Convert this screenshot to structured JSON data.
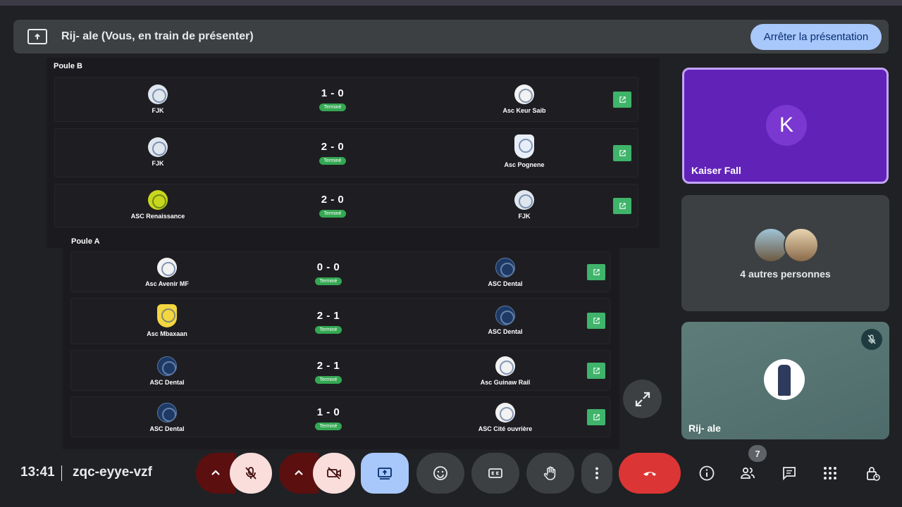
{
  "banner": {
    "title": "Rij- ale (Vous, en train de présenter)",
    "stop_label": "Arrêter la présentation"
  },
  "shared": {
    "poule_b": {
      "label": "Poule B",
      "matches": [
        {
          "home": "FJK",
          "score": "1 - 0",
          "status": "Terminé",
          "away": "Asc Keur Saib"
        },
        {
          "home": "FJK",
          "score": "2 - 0",
          "status": "Terminé",
          "away": "Asc Pognene"
        },
        {
          "home": "ASC Renaissance",
          "score": "2 - 0",
          "status": "Terminé",
          "away": "FJK"
        }
      ]
    },
    "poule_a": {
      "label": "Poule A",
      "matches": [
        {
          "home": "Asc Avenir MF",
          "score": "0 - 0",
          "status": "Terminé",
          "away": "ASC Dental"
        },
        {
          "home": "Asc Mbaxaan",
          "score": "2 - 1",
          "status": "Terminé",
          "away": "ASC Dental"
        },
        {
          "home": "ASC Dental",
          "score": "2 - 1",
          "status": "Terminé",
          "away": "Asc Guinaw Rail"
        },
        {
          "home": "ASC Dental",
          "score": "1 - 0",
          "status": "Terminé",
          "away": "ASC Cité ouvrière"
        }
      ]
    }
  },
  "participants": {
    "kaiser": {
      "initial": "K",
      "name": "Kaiser Fall"
    },
    "others": {
      "label": "4 autres personnes"
    },
    "self": {
      "name": "Rij- ale"
    }
  },
  "bottom": {
    "time": "13:41",
    "meeting_code": "zqc-eyye-vzf",
    "people_count": "7"
  },
  "colors": {
    "accent_blue": "#a8c7fa",
    "hangup_red": "#dc3535",
    "status_green": "#34a853",
    "speaker_tile": "#6122b8"
  }
}
